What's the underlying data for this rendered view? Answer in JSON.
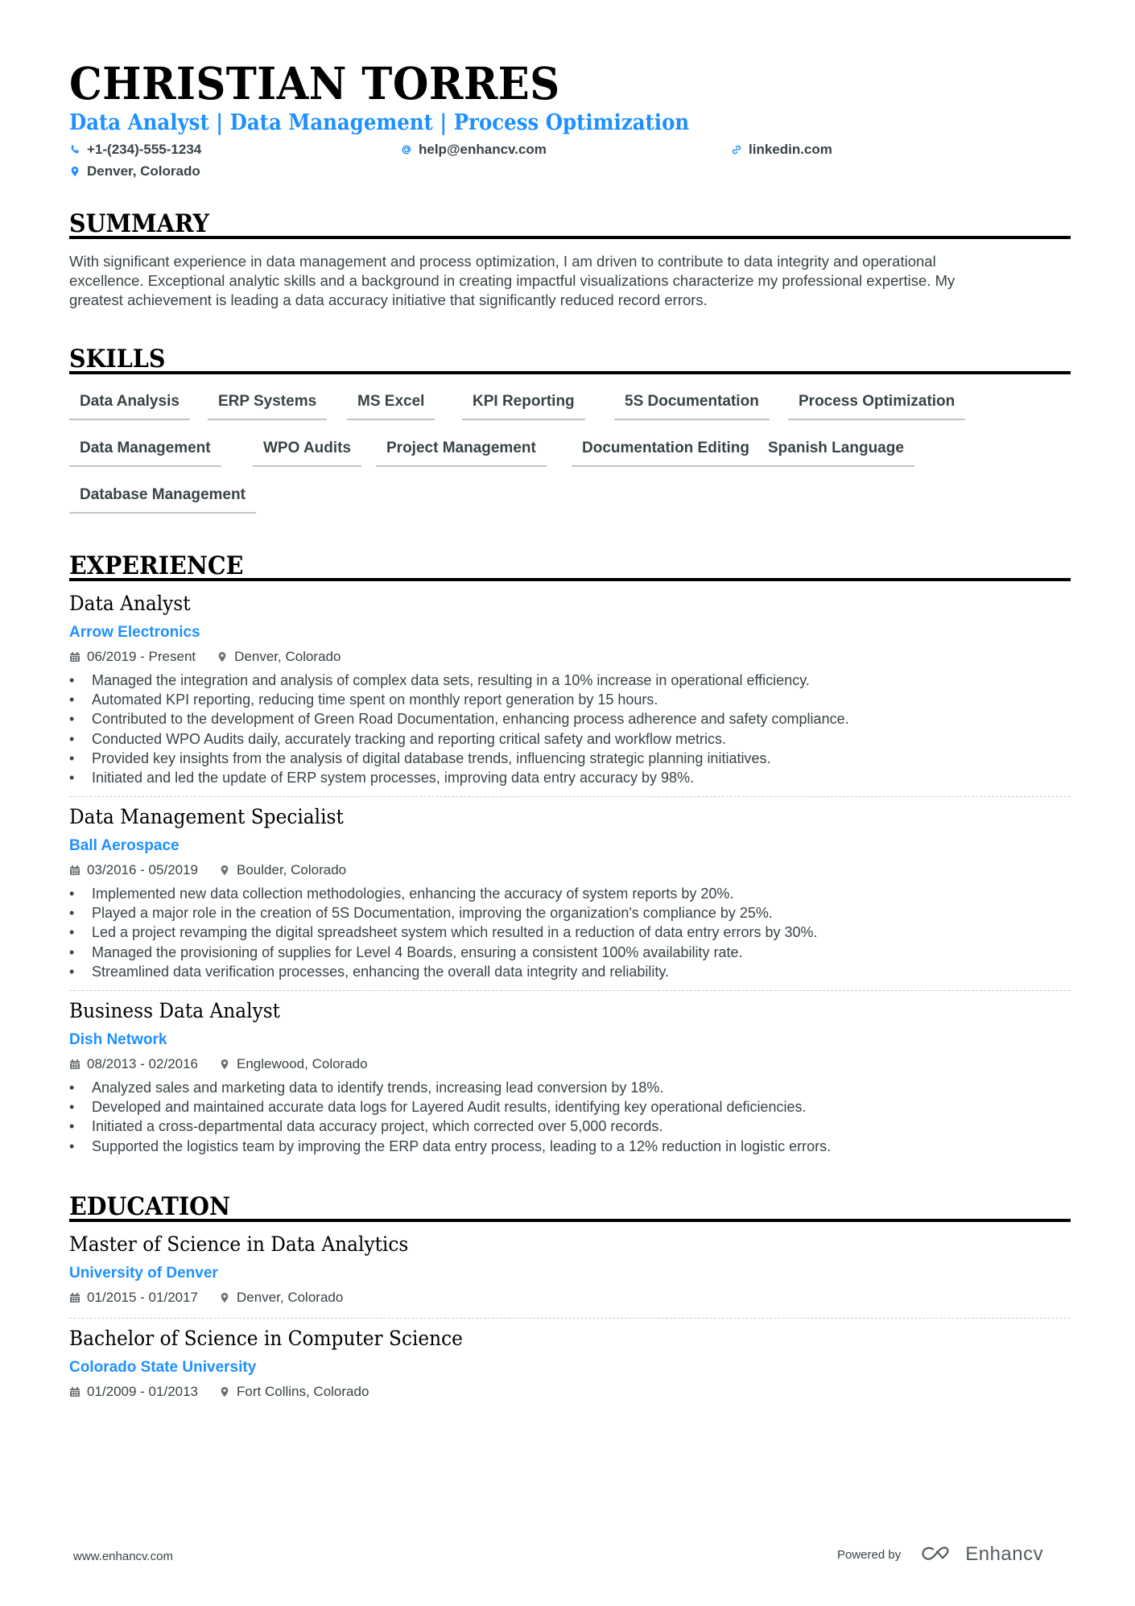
{
  "header": {
    "name": "CHRISTIAN TORRES",
    "title": "Data Analyst | Data Management | Process Optimization",
    "contacts": {
      "phone": {
        "icon": "phone-icon",
        "value": "+1-(234)-555-1234"
      },
      "email": {
        "icon": "at-icon",
        "value": "help@enhancv.com"
      },
      "website": {
        "icon": "link-icon",
        "value": "linkedin.com"
      },
      "location": {
        "icon": "location-pin-icon",
        "value": "Denver, Colorado"
      }
    }
  },
  "colors": {
    "accent": "#1e90ff",
    "text": "#384347",
    "heading": "#000000"
  },
  "summary": {
    "heading": "SUMMARY",
    "lines": [
      "With significant experience in data management and process optimization, I am driven to contribute to data integrity and operational",
      "excellence. Exceptional analytic skills and a background in creating impactful visualizations characterize my professional expertise. My",
      "greatest achievement is leading a data accuracy initiative that significantly reduced record errors."
    ]
  },
  "skills": {
    "heading": "SKILLS",
    "items": [
      "Data Analysis",
      "ERP Systems",
      "MS Excel",
      "KPI Reporting",
      "5S Documentation",
      "Process Optimization",
      "Data Management",
      "WPO Audits",
      "Project Management",
      "Documentation Editing",
      "Spanish Language",
      "Database Management"
    ]
  },
  "experience": {
    "heading": "EXPERIENCE",
    "jobs": [
      {
        "title": "Data Analyst",
        "company": "Arrow Electronics",
        "dates": "06/2019 - Present",
        "location": "Denver, Colorado",
        "bullets": [
          "Managed the integration and analysis of complex data sets, resulting in a 10% increase in operational efficiency.",
          "Automated KPI reporting, reducing time spent on monthly report generation by 15 hours.",
          "Contributed to the development of Green Road Documentation, enhancing process adherence and safety compliance.",
          "Conducted WPO Audits daily, accurately tracking and reporting critical safety and workflow metrics.",
          "Provided key insights from the analysis of digital database trends, influencing strategic planning initiatives.",
          "Initiated and led the update of ERP system processes, improving data entry accuracy by 98%."
        ]
      },
      {
        "title": "Data Management Specialist",
        "company": "Ball Aerospace",
        "dates": "03/2016 - 05/2019",
        "location": "Boulder, Colorado",
        "bullets": [
          "Implemented new data collection methodologies, enhancing the accuracy of system reports by 20%.",
          "Played a major role in the creation of 5S Documentation, improving the organization's compliance by 25%.",
          "Led a project revamping the digital spreadsheet system which resulted in a reduction of data entry errors by 30%.",
          "Managed the provisioning of supplies for Level 4 Boards, ensuring a consistent 100% availability rate.",
          "Streamlined data verification processes, enhancing the overall data integrity and reliability."
        ]
      },
      {
        "title": "Business Data Analyst",
        "company": "Dish Network",
        "dates": "08/2013 - 02/2016",
        "location": "Englewood, Colorado",
        "bullets": [
          "Analyzed sales and marketing data to identify trends, increasing lead conversion by 18%.",
          "Developed and maintained accurate data logs for Layered Audit results, identifying key operational deficiencies.",
          "Initiated a cross-departmental data accuracy project, which corrected over 5,000 records.",
          "Supported the logistics team by improving the ERP data entry process, leading to a 12% reduction in logistic errors."
        ]
      }
    ]
  },
  "education": {
    "heading": "EDUCATION",
    "entries": [
      {
        "degree": "Master of Science in Data Analytics",
        "school": "University of Denver",
        "dates": "01/2015 - 01/2017",
        "location": "Denver, Colorado"
      },
      {
        "degree": "Bachelor of Science in Computer Science",
        "school": "Colorado State University",
        "dates": "01/2009 - 01/2013",
        "location": "Fort Collins, Colorado"
      }
    ]
  },
  "footer": {
    "website": "www.enhancv.com",
    "powered_by": "Powered by",
    "brand": "Enhancv",
    "brand_icon": "enhancv-logo-icon"
  }
}
